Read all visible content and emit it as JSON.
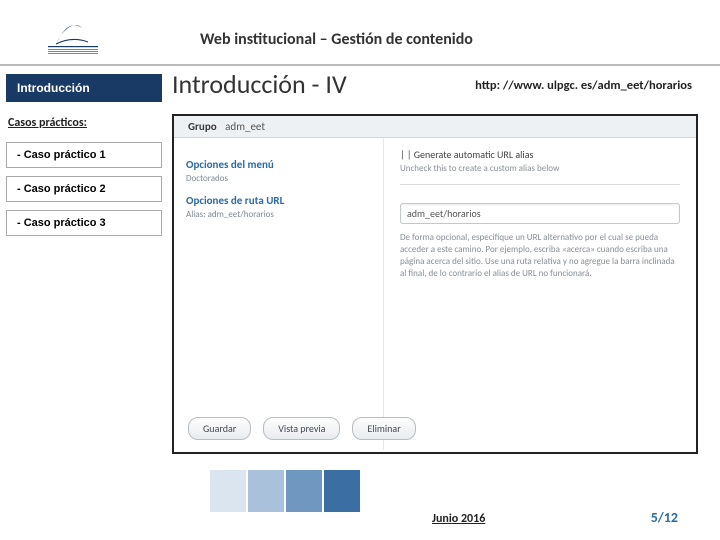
{
  "header": {
    "title": "Web institucional – Gestión de contenido"
  },
  "sidebar": {
    "intro": "Introducción",
    "section_label": "Casos prácticos:",
    "items": [
      "- Caso práctico 1",
      "- Caso práctico 2",
      "- Caso práctico 3"
    ]
  },
  "main": {
    "title": "Introducción - IV",
    "url_prefix": "http: //www. ulpgc. es/",
    "url_bold": "adm_eet/horarios"
  },
  "screenshot": {
    "group_label": "Grupo",
    "group_value": "adm_eet",
    "left": {
      "menu_title": "Opciones del menú",
      "menu_sub": "Doctorados",
      "url_title": "Opciones de ruta URL",
      "url_sub": "Alias: adm_eet/horarios"
    },
    "right": {
      "checkbox": "|  | Generate automatic URL alias",
      "check_hint": "Uncheck this to create a custom alias below",
      "input_value": "adm_eet/horarios",
      "help": "De forma opcional, especifique un URL alternativo por el cual se pueda acceder a este camino. Por ejemplo, escriba «acerca» cuando escriba una página acerca del sitio. Use una ruta relativa y no agregue la barra inclinada al final, de lo contrario el alias de URL no funcionará."
    },
    "actions": {
      "save": "Guardar",
      "preview": "Vista previa",
      "delete": "Eliminar"
    }
  },
  "footer": {
    "date": "Junio 2016",
    "page": "5/12"
  }
}
